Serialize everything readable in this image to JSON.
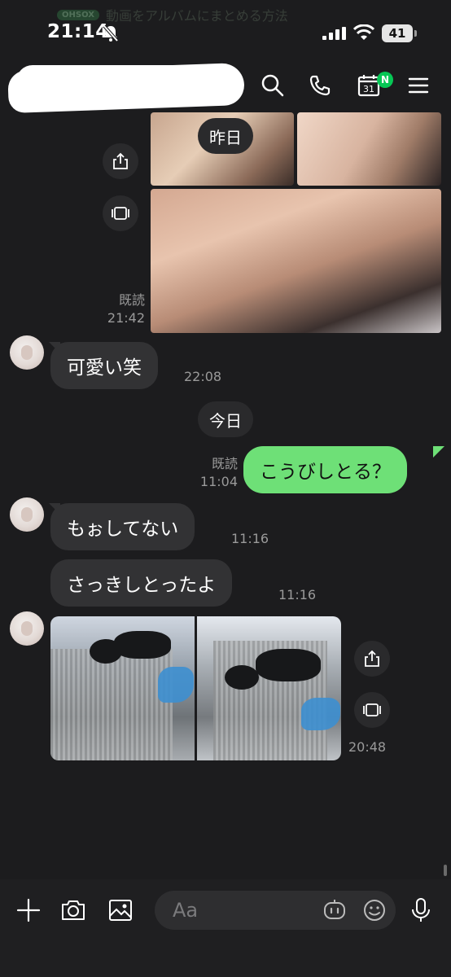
{
  "status_bar": {
    "time": "21:14",
    "battery": "41",
    "notification_text": "動画をアルバムにまとめる方法",
    "notification_badge": "OHSOX"
  },
  "header": {
    "calendar_day": "31",
    "calendar_badge": "N",
    "icons": [
      "search-icon",
      "phone-icon",
      "calendar-icon",
      "menu-icon"
    ]
  },
  "messages": {
    "date_yesterday": "昨日",
    "photos_1": {
      "status": "既読",
      "time": "21:42"
    },
    "msg_kawaii": {
      "text": "可愛い笑",
      "time": "22:08"
    },
    "date_today": "今日",
    "msg_out": {
      "text": "こうびしとる？",
      "status": "既読",
      "time": "11:04"
    },
    "msg_moshitenai": {
      "text": "もぉしてない",
      "time": "11:16"
    },
    "msg_sakki": {
      "text": "さっきしとったよ",
      "time": "11:16"
    },
    "photos_2": {
      "time": "20:48"
    }
  },
  "input_bar": {
    "placeholder": "Aa"
  },
  "colors": {
    "background": "#1c1c1e",
    "bubble_in": "#323234",
    "bubble_out": "#6ee077",
    "accent_green": "#06c755"
  }
}
